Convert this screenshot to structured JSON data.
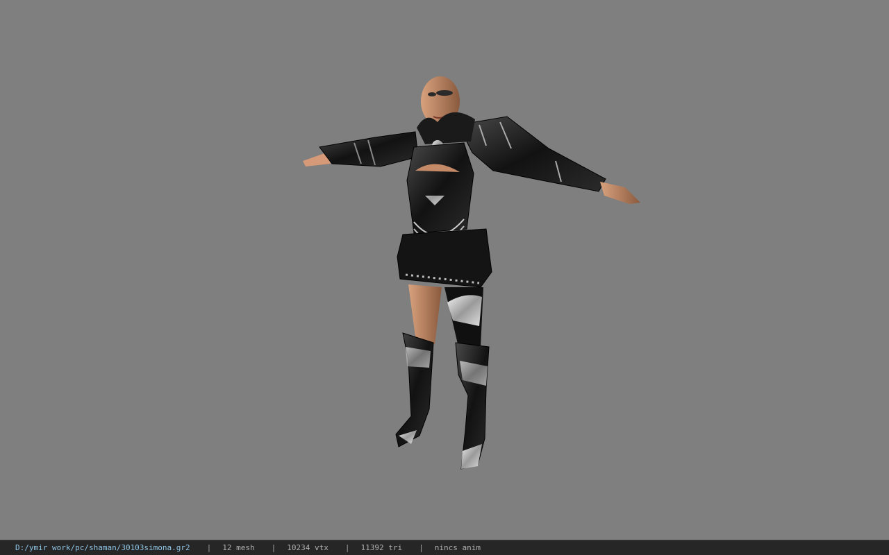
{
  "viewport": {
    "background_color": "#7f7f7f"
  },
  "model": {
    "icon": "character-model-preview"
  },
  "statusbar": {
    "file_path": "D:/ymir work/pc/shaman/30103simona.gr2",
    "mesh_count": "12 mesh",
    "vertex_count": "10234 vtx",
    "triangle_count": "11392 tri",
    "animation": "nincs anim",
    "separator": "|",
    "path_color": "#8fc7e8",
    "background_color": "#262626"
  }
}
